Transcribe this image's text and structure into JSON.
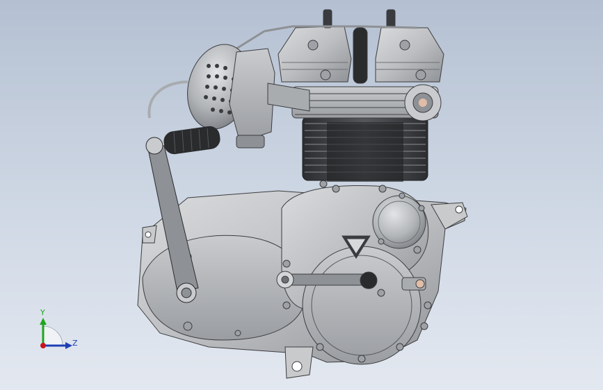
{
  "viewport": {
    "background_top": "#b4c0d2",
    "background_bottom": "#e3e8f0"
  },
  "model": {
    "body_color": "#bfc1c3",
    "shadow_color": "#8c8f93",
    "dark_color": "#2a2b2d",
    "fin_color": "#3a3b3e"
  },
  "triad": {
    "y_label": "Y",
    "z_label": "Z",
    "y_color": "#1fa51f",
    "z_color": "#1f3fb4",
    "x_color": "#c8141e"
  }
}
